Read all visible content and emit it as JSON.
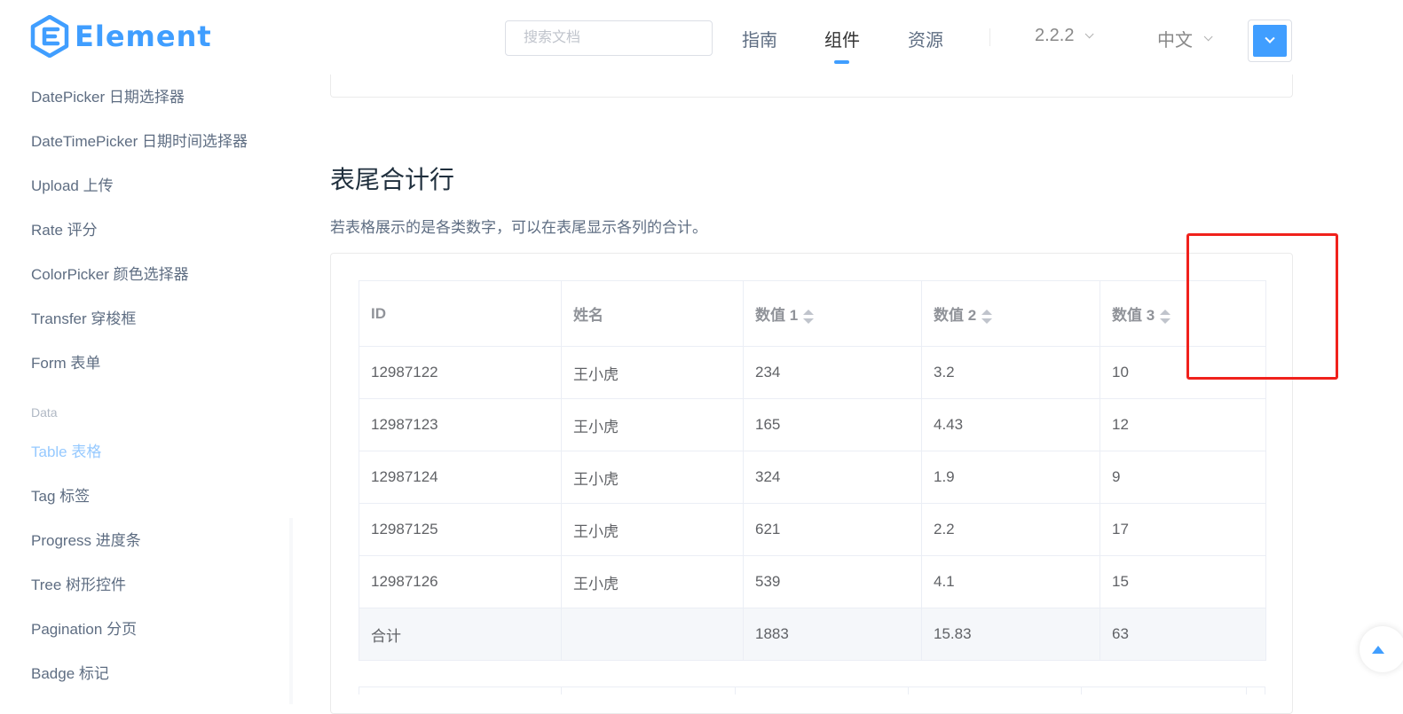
{
  "header": {
    "logo_text": "Element",
    "search": {
      "placeholder": "搜索文档",
      "value": ""
    },
    "nav": [
      {
        "label": "指南",
        "active": false
      },
      {
        "label": "组件",
        "active": true
      },
      {
        "label": "资源",
        "active": false
      }
    ],
    "version": "2.2.2",
    "language": "中文",
    "accent_color": "#409eff"
  },
  "sidebar": {
    "items_top": [
      "DatePicker 日期选择器",
      "DateTimePicker 日期时间选择器",
      "Upload 上传",
      "Rate 评分",
      "ColorPicker 颜色选择器",
      "Transfer 穿梭框",
      "Form 表单"
    ],
    "group_label": "Data",
    "items_data": [
      "Table 表格",
      "Tag 标签",
      "Progress 进度条",
      "Tree 树形控件",
      "Pagination 分页",
      "Badge 标记"
    ],
    "active_item": "Table 表格"
  },
  "section": {
    "title": "表尾合计行",
    "description": "若表格展示的是各类数字，可以在表尾显示各列的合计。"
  },
  "table": {
    "columns": [
      "ID",
      "姓名",
      "数值 1",
      "数值 2",
      "数值 3"
    ],
    "sortable": [
      false,
      false,
      true,
      true,
      true
    ],
    "rows": [
      [
        "12987122",
        "王小虎",
        "234",
        "3.2",
        "10"
      ],
      [
        "12987123",
        "王小虎",
        "165",
        "4.43",
        "12"
      ],
      [
        "12987124",
        "王小虎",
        "324",
        "1.9",
        "9"
      ],
      [
        "12987125",
        "王小虎",
        "621",
        "2.2",
        "17"
      ],
      [
        "12987126",
        "王小虎",
        "539",
        "4.1",
        "15"
      ]
    ],
    "summary": [
      "合计",
      "",
      "1883",
      "15.83",
      "63"
    ]
  }
}
